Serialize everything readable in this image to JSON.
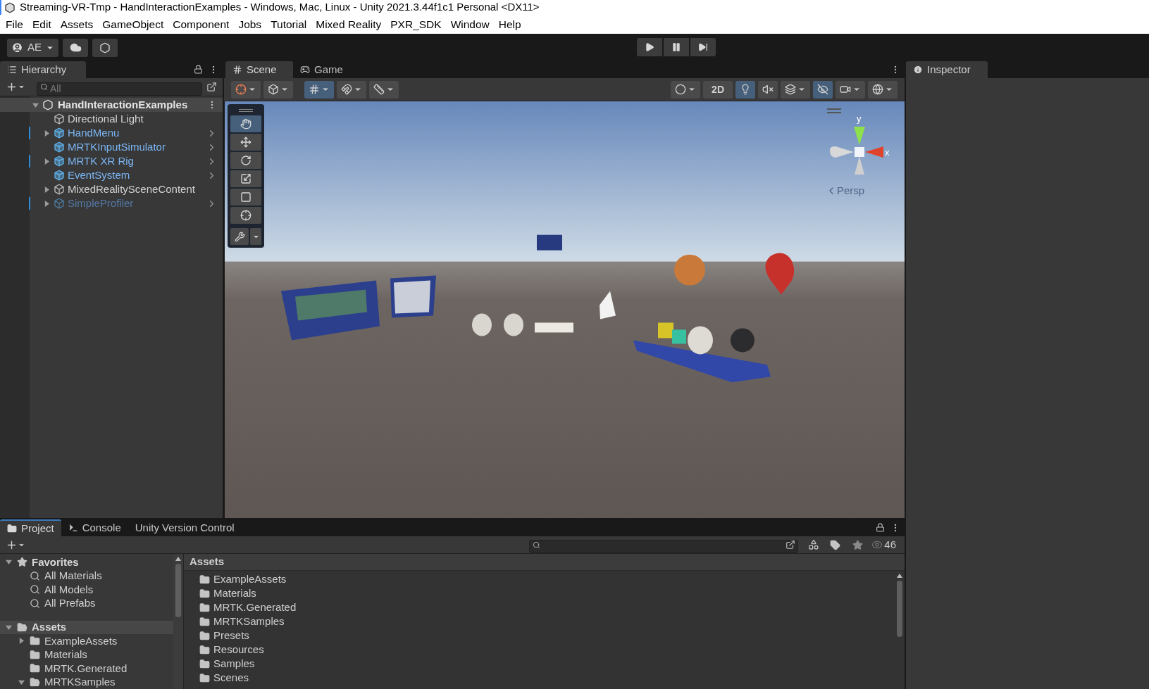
{
  "window": {
    "title": "Streaming-VR-Tmp - HandInteractionExamples - Windows, Mac, Linux - Unity 2021.3.44f1c1 Personal <DX11>"
  },
  "menu": [
    "File",
    "Edit",
    "Assets",
    "GameObject",
    "Component",
    "Jobs",
    "Tutorial",
    "Mixed Reality",
    "PXR_SDK",
    "Window",
    "Help"
  ],
  "toolbar": {
    "account": "AE"
  },
  "hierarchy": {
    "tab": "Hierarchy",
    "search_placeholder": "All",
    "root": {
      "name": "HandInteractionExamples",
      "expanded": true,
      "children": [
        {
          "name": "Directional Light",
          "kind": "object",
          "active": true,
          "overridden": false
        },
        {
          "name": "HandMenu",
          "kind": "prefab",
          "active": true,
          "overridden": true,
          "expanded": false
        },
        {
          "name": "MRTKInputSimulator",
          "kind": "prefab",
          "active": true,
          "overridden": false
        },
        {
          "name": "MRTK XR Rig",
          "kind": "prefab",
          "active": true,
          "overridden": true,
          "expanded": false
        },
        {
          "name": "EventSystem",
          "kind": "prefab",
          "active": true,
          "overridden": false
        },
        {
          "name": "MixedRealitySceneContent",
          "kind": "object",
          "active": true,
          "overridden": false,
          "expanded": false
        },
        {
          "name": "SimpleProfiler",
          "kind": "prefab",
          "active": false,
          "overridden": true,
          "expanded": false
        }
      ]
    }
  },
  "scene_tabs": [
    {
      "label": "Scene",
      "kind": "scene",
      "selected": true
    },
    {
      "label": "Game",
      "kind": "game",
      "selected": false
    }
  ],
  "scene_toolbar": [
    {
      "kind": "handle",
      "on": false,
      "dropdown": true
    },
    {
      "kind": "draw-mode",
      "on": false,
      "dropdown": true
    },
    {
      "kind": "grid",
      "on": true,
      "dropdown": true
    },
    {
      "kind": "snap",
      "on": false,
      "dropdown": true
    },
    {
      "kind": "increment",
      "on": false,
      "dropdown": true
    },
    {
      "kind": "shading",
      "on": false,
      "dropdown": true
    },
    {
      "kind": "dimension",
      "label": "2D",
      "on": false,
      "dropdown": false
    },
    {
      "kind": "lighting",
      "on": true,
      "dropdown": false
    },
    {
      "kind": "audio",
      "on": false,
      "dropdown": false
    },
    {
      "kind": "effects",
      "on": false,
      "dropdown": true
    },
    {
      "kind": "visibility",
      "on": true,
      "dropdown": false
    },
    {
      "kind": "camera",
      "on": false,
      "dropdown": true
    },
    {
      "kind": "gizmos",
      "on": false,
      "dropdown": true
    }
  ],
  "tools": [
    {
      "kind": "hand",
      "selected": true
    },
    {
      "kind": "move",
      "selected": false
    },
    {
      "kind": "rotate",
      "selected": false
    },
    {
      "kind": "scale",
      "selected": false
    },
    {
      "kind": "rect",
      "selected": false
    },
    {
      "kind": "transform",
      "selected": false
    }
  ],
  "gizmo": {
    "y_label": "y",
    "x_label": "x",
    "projection": "Persp"
  },
  "inspector": {
    "tab": "Inspector"
  },
  "bottom_tabs": [
    {
      "label": "Project",
      "kind": "project",
      "selected": true
    },
    {
      "label": "Console",
      "kind": "console",
      "selected": false
    },
    {
      "label": "Unity Version Control",
      "kind": "vcs",
      "selected": false
    }
  ],
  "project": {
    "hidden_count": "46",
    "tree": [
      {
        "label": "Favorites",
        "kind": "favorites",
        "expanded": true,
        "selected": false,
        "children": [
          {
            "label": "All Materials",
            "kind": "search",
            "selected": false
          },
          {
            "label": "All Models",
            "kind": "search",
            "selected": false
          },
          {
            "label": "All Prefabs",
            "kind": "search",
            "selected": false
          }
        ]
      },
      {
        "label": "Assets",
        "kind": "folder",
        "expanded": true,
        "selected": true,
        "children": [
          {
            "label": "ExampleAssets",
            "kind": "folder",
            "expanded": false,
            "selected": false
          },
          {
            "label": "Materials",
            "kind": "folder",
            "selected": false
          },
          {
            "label": "MRTK.Generated",
            "kind": "folder",
            "selected": false
          },
          {
            "label": "MRTKSamples",
            "kind": "folder",
            "expanded": true,
            "selected": false
          }
        ]
      }
    ],
    "breadcrumb": "Assets",
    "items": [
      "ExampleAssets",
      "Materials",
      "MRTK.Generated",
      "MRTKSamples",
      "Presets",
      "Resources",
      "Samples",
      "Scenes"
    ]
  }
}
